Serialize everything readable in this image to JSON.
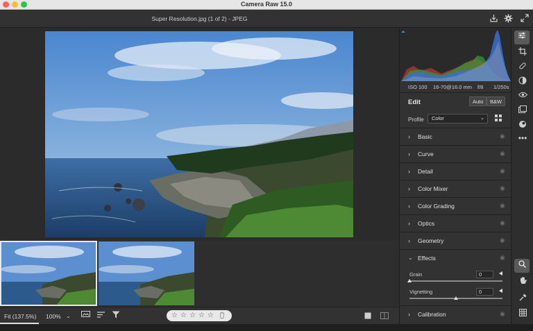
{
  "window": {
    "title": "Camera Raw 15.0"
  },
  "header": {
    "filename": "Super Resolution.jpg (1 of 2)  -  JPEG"
  },
  "exif": {
    "iso": "ISO 100",
    "lens": "16-70@16.0 mm",
    "aperture": "f/8",
    "shutter": "1/250s"
  },
  "edit": {
    "title": "Edit",
    "auto_label": "Auto",
    "bw_label": "B&W",
    "profile_label": "Profile",
    "profile_value": "Color"
  },
  "sections": {
    "basic": "Basic",
    "curve": "Curve",
    "detail": "Detail",
    "color_mixer": "Color Mixer",
    "color_grading": "Color Grading",
    "optics": "Optics",
    "geometry": "Geometry",
    "effects": "Effects",
    "calibration": "Calibration"
  },
  "effects": {
    "grain_label": "Grain",
    "grain_value": "0",
    "grain_level": 0,
    "vignetting_label": "Vignetting",
    "vignetting_value": "0",
    "vignetting_level": 0.5
  },
  "bottom": {
    "zoom_fit": "Fit (137.5%)",
    "zoom_100": "100%",
    "rating_stars": 0
  },
  "icons": {
    "save": "save-icon",
    "settings": "gear-icon",
    "fullscreen": "expand-icon",
    "edit": "sliders-icon",
    "crop": "crop-icon",
    "heal": "bandage-icon",
    "mask": "mask-icon",
    "redeye": "eye-icon",
    "snapshots": "snapshot-icon",
    "presets": "presets-icon",
    "more": "more-icon",
    "zoom": "magnifier-icon",
    "hand": "hand-icon",
    "sampler": "eyedropper-icon",
    "grid": "grid-icon"
  },
  "colors": {
    "panel": "#323232",
    "canvas": "#2b2b2b",
    "accent": "#2d8ceb"
  }
}
